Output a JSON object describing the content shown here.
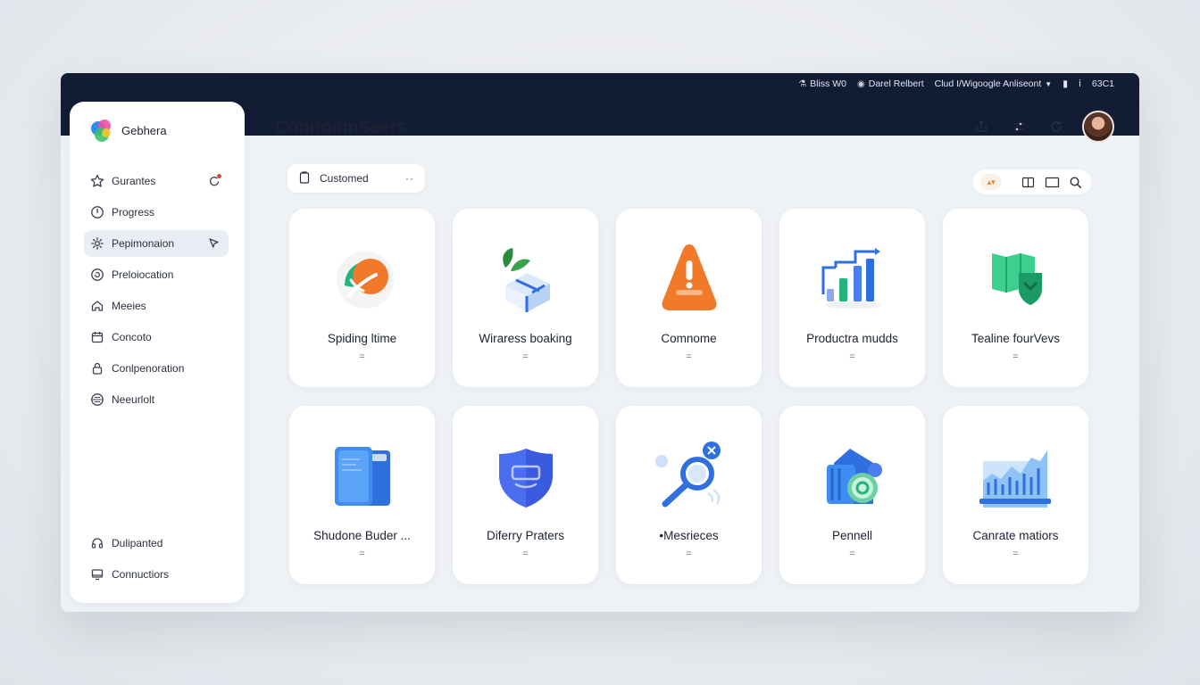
{
  "topbar": {
    "items": [
      {
        "icon": "flask-icon",
        "label": "Bliss W0"
      },
      {
        "icon": "user-circle-icon",
        "label": "Darel Relbert"
      },
      {
        "label": "Clud I/Wigoogle Anliseont"
      },
      {
        "icon": "mobile-icon",
        "label": ""
      },
      {
        "icon": "info-icon",
        "label": ""
      },
      {
        "label": "63C1"
      }
    ]
  },
  "brand": {
    "name": "Gebhera"
  },
  "sidebar": {
    "items": [
      {
        "label": "Gurantes",
        "icon": "star-icon",
        "trailing_icon": "refresh-alert-icon",
        "badge_color": "#e8452f",
        "active": false
      },
      {
        "label": "Progress",
        "icon": "power-circle-icon",
        "active": false
      },
      {
        "label": "Pepimonaion",
        "icon": "gear-icon",
        "trailing_icon": "cursor-icon",
        "active": true
      },
      {
        "label": "Preloiocation",
        "icon": "refresh-icon",
        "active": false
      },
      {
        "label": "Meeies",
        "icon": "home-icon",
        "active": false
      },
      {
        "label": "Concoto",
        "icon": "calendar-icon",
        "active": false
      },
      {
        "label": "Conlpenoration",
        "icon": "lock-icon",
        "active": false
      },
      {
        "label": "Neeurlolt",
        "icon": "globe-icon",
        "active": false
      }
    ],
    "bottom_items": [
      {
        "label": "Dulipanted",
        "icon": "headset-icon"
      },
      {
        "label": "Connuctiors",
        "icon": "monitor-icon"
      }
    ]
  },
  "page": {
    "title": "ConifoomSeers"
  },
  "filter": {
    "label": "Customed",
    "more": "··"
  },
  "header_actions": [
    "share-icon",
    "sliders-icon",
    "refresh-icon",
    "avatar"
  ],
  "view_toolbar": {
    "badge": "▴▾",
    "icons": [
      "columns-icon",
      "monitor-icon",
      "search-icon"
    ]
  },
  "cards": [
    {
      "title": "Spiding ltime",
      "sub": "=",
      "icon": "leaf-orange-icon"
    },
    {
      "title": "Wiraress boaking",
      "sub": "=",
      "icon": "package-leaf-icon"
    },
    {
      "title": "Comnome",
      "sub": "=",
      "icon": "warning-cone-icon"
    },
    {
      "title": "Productra mudds",
      "sub": "=",
      "icon": "bar-chart-icon"
    },
    {
      "title": "Tealine fourVevs",
      "sub": "=",
      "icon": "shield-map-icon"
    },
    {
      "title": "Shudone Buder ...",
      "sub": "=",
      "icon": "folder-icon"
    },
    {
      "title": "Diferry Praters",
      "sub": "=",
      "icon": "shield-icon"
    },
    {
      "title": "•Mesrieces",
      "sub": "=",
      "icon": "magnifier-icon"
    },
    {
      "title": "Pennell",
      "sub": "=",
      "icon": "wallet-coin-icon"
    },
    {
      "title": "Canrate matiors",
      "sub": "=",
      "icon": "area-chart-icon"
    }
  ],
  "colors": {
    "topbar": "#121d35",
    "accent_blue": "#2f6fe0",
    "accent_green": "#27c27a",
    "accent_orange": "#f07a2a",
    "accent_red": "#e8452f"
  }
}
